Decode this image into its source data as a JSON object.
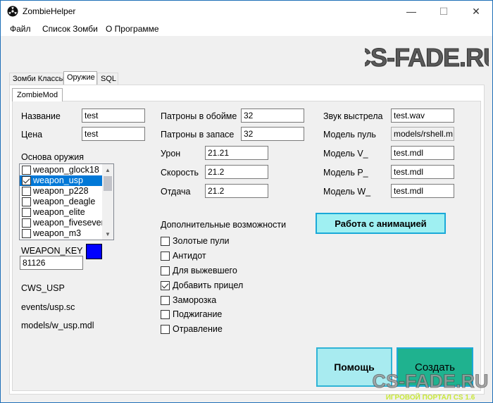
{
  "window": {
    "title": "ZombieHelper",
    "minimize_glyph": "—",
    "maximize_glyph": "☐",
    "close_glyph": "✕"
  },
  "menu": [
    "Файл",
    "Список Зомби",
    "О Программе"
  ],
  "logo_top": "CS-FADE.RU",
  "tabs": [
    "Зомби Классы",
    "Оружие",
    "SQL"
  ],
  "active_tab": "Оружие",
  "subtab": "ZombieMod",
  "left": {
    "name_label": "Название",
    "name_value": "test",
    "price_label": "Цена",
    "price_value": "test",
    "base_label": "Основа оружия",
    "weapons": [
      {
        "label": "weapon_glock18",
        "checked": false,
        "selected": false
      },
      {
        "label": "weapon_usp",
        "checked": true,
        "selected": true
      },
      {
        "label": "weapon_p228",
        "checked": false,
        "selected": false
      },
      {
        "label": "weapon_deagle",
        "checked": false,
        "selected": false
      },
      {
        "label": "weapon_elite",
        "checked": false,
        "selected": false
      },
      {
        "label": "weapon_fivesever",
        "checked": false,
        "selected": false
      },
      {
        "label": "weapon_m3",
        "checked": false,
        "selected": false
      }
    ],
    "scroll_up": "▲",
    "scroll_down": "▼",
    "key_label": "WEAPON_KEY",
    "key_value": "81126",
    "key_color": "#0000ff",
    "info1": "CWS_USP",
    "info2": "events/usp.sc",
    "info3": "models/w_usp.mdl"
  },
  "middle": {
    "clip_label": "Патроны в обойме",
    "clip_value": "32",
    "reserve_label": "Патроны в запасе",
    "reserve_value": "32",
    "damage_label": "Урон",
    "damage_value": "21.21",
    "speed_label": "Скорость",
    "speed_value": "21.2",
    "recoil_label": "Отдача",
    "recoil_value": "21.2",
    "extra_label": "Дополнительные возможности",
    "options": [
      {
        "label": "Золотые пули",
        "checked": false
      },
      {
        "label": "Антидот",
        "checked": false
      },
      {
        "label": "Для выжевшего",
        "checked": false
      },
      {
        "label": "Добавить прицел",
        "checked": true
      },
      {
        "label": "Заморозка",
        "checked": false
      },
      {
        "label": "Поджигание",
        "checked": false
      },
      {
        "label": "Отравление",
        "checked": false
      }
    ]
  },
  "right": {
    "sound_label": "Звук выстрела",
    "sound_value": "test.wav",
    "shell_label": "Модель пуль",
    "shell_value": "models/rshell.m",
    "v_label": "Модель V_",
    "v_value": "test.mdl",
    "p_label": "Модель P_",
    "p_value": "test.mdl",
    "w_label": "Модель W_",
    "w_value": "test.mdl",
    "anim_button": "Работа с анимацией"
  },
  "help_button": "Помощь",
  "create_button": "Создать",
  "watermark": {
    "title": "CS-FADE.RU",
    "subtitle": "ИГРОВОЙ ПОРТАЛ CS 1.6"
  }
}
